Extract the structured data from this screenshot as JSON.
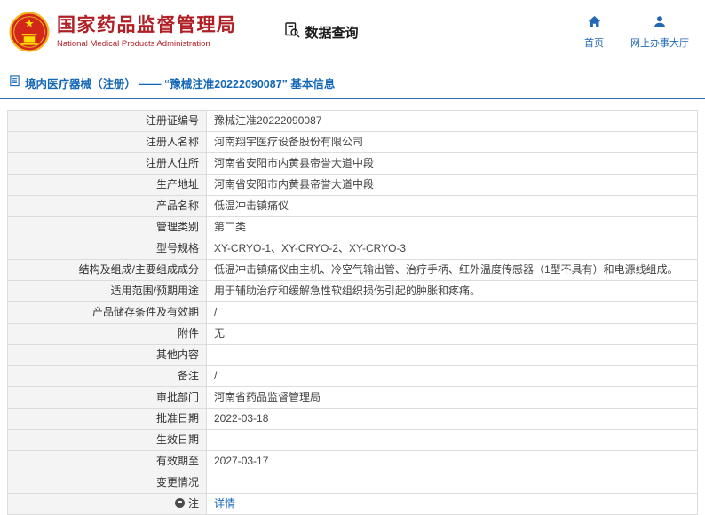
{
  "header": {
    "org_name_cn": "国家药品监督管理局",
    "org_name_en": "National Medical Products Administration",
    "section_title": "数据查询",
    "nav_home": "首页",
    "nav_hall": "网上办事大厅"
  },
  "breadcrumb": {
    "title": "境内医疗器械（注册） ——  “豫械注准20222090087”  基本信息"
  },
  "colors": {
    "brand_red": "#b01f24",
    "accent_blue": "#2e6cb5",
    "link_blue": "#1568b6"
  },
  "table": {
    "rows": [
      {
        "label": "注册证编号",
        "value": "豫械注准20222090087"
      },
      {
        "label": "注册人名称",
        "value": "河南翔宇医疗设备股份有限公司"
      },
      {
        "label": "注册人住所",
        "value": "河南省安阳市内黄县帝誉大道中段"
      },
      {
        "label": "生产地址",
        "value": "河南省安阳市内黄县帝誉大道中段"
      },
      {
        "label": "产品名称",
        "value": "低温冲击镇痛仪"
      },
      {
        "label": "管理类别",
        "value": "第二类"
      },
      {
        "label": "型号规格",
        "value": "XY-CRYO-1、XY-CRYO-2、XY-CRYO-3"
      },
      {
        "label": "结构及组成/主要组成成分",
        "value": "低温冲击镇痛仪由主机、冷空气输出管、治疗手柄、红外温度传感器（1型不具有）和电源线组成。"
      },
      {
        "label": "适用范围/预期用途",
        "value": "用于辅助治疗和缓解急性软组织损伤引起的肿胀和疼痛。"
      },
      {
        "label": "产品储存条件及有效期",
        "value": "/"
      },
      {
        "label": "附件",
        "value": "无"
      },
      {
        "label": "其他内容",
        "value": ""
      },
      {
        "label": "备注",
        "value": "/"
      },
      {
        "label": "审批部门",
        "value": "河南省药品监督管理局"
      },
      {
        "label": "批准日期",
        "value": "2022-03-18"
      },
      {
        "label": "生效日期",
        "value": ""
      },
      {
        "label": "有效期至",
        "value": "2027-03-17"
      },
      {
        "label": "变更情况",
        "value": ""
      },
      {
        "label": "注",
        "value": "详情",
        "label_icon": "note-icon",
        "value_is_link": true
      }
    ]
  }
}
